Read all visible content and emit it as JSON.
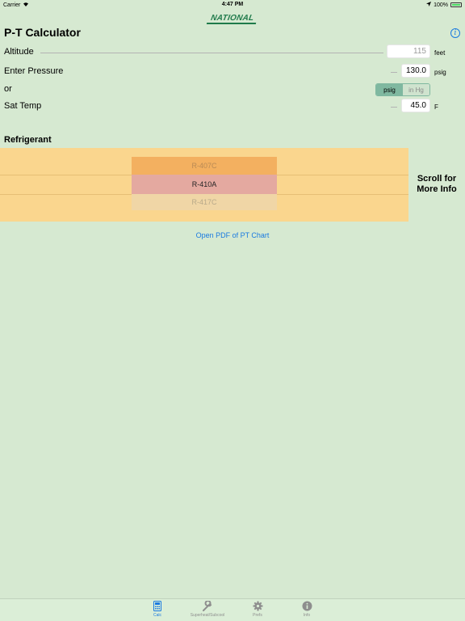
{
  "status_bar": {
    "carrier": "Carrier",
    "time": "4:47 PM",
    "battery": "100%"
  },
  "logo_text": "NATIONAL",
  "header": {
    "title": "P-T Calculator"
  },
  "altitude": {
    "label": "Altitude",
    "value": "115",
    "unit": "feet"
  },
  "pressure": {
    "label": "Enter Pressure",
    "value": "130.0",
    "unit": "psig"
  },
  "or_row": {
    "label": "or",
    "options": [
      "psig",
      "in Hg"
    ],
    "selected": "psig"
  },
  "sat_temp": {
    "label": "Sat Temp",
    "value": "45.0",
    "unit": "F"
  },
  "refrigerant": {
    "title": "Refrigerant",
    "options": [
      "R-407C",
      "R-410A",
      "R-417C"
    ],
    "selected": "R-410A",
    "scroll_note_line1": "Scroll for",
    "scroll_note_line2": "More Info"
  },
  "pdf_link": "Open PDF of PT Chart",
  "tabs": [
    {
      "label": "Calc",
      "icon": "calculator-icon",
      "active": true
    },
    {
      "label": "Superheat/Subcool",
      "icon": "wrench-icon",
      "active": false
    },
    {
      "label": "Prefs",
      "icon": "gear-icon",
      "active": false
    },
    {
      "label": "Info",
      "icon": "info-icon",
      "active": false
    }
  ],
  "colors": {
    "background": "#d6e9d1",
    "accent": "#1a7ae0",
    "picker_bg": "#fad68e",
    "selected_row": "#e4a9a0",
    "brand_green": "#1f7a4a"
  }
}
